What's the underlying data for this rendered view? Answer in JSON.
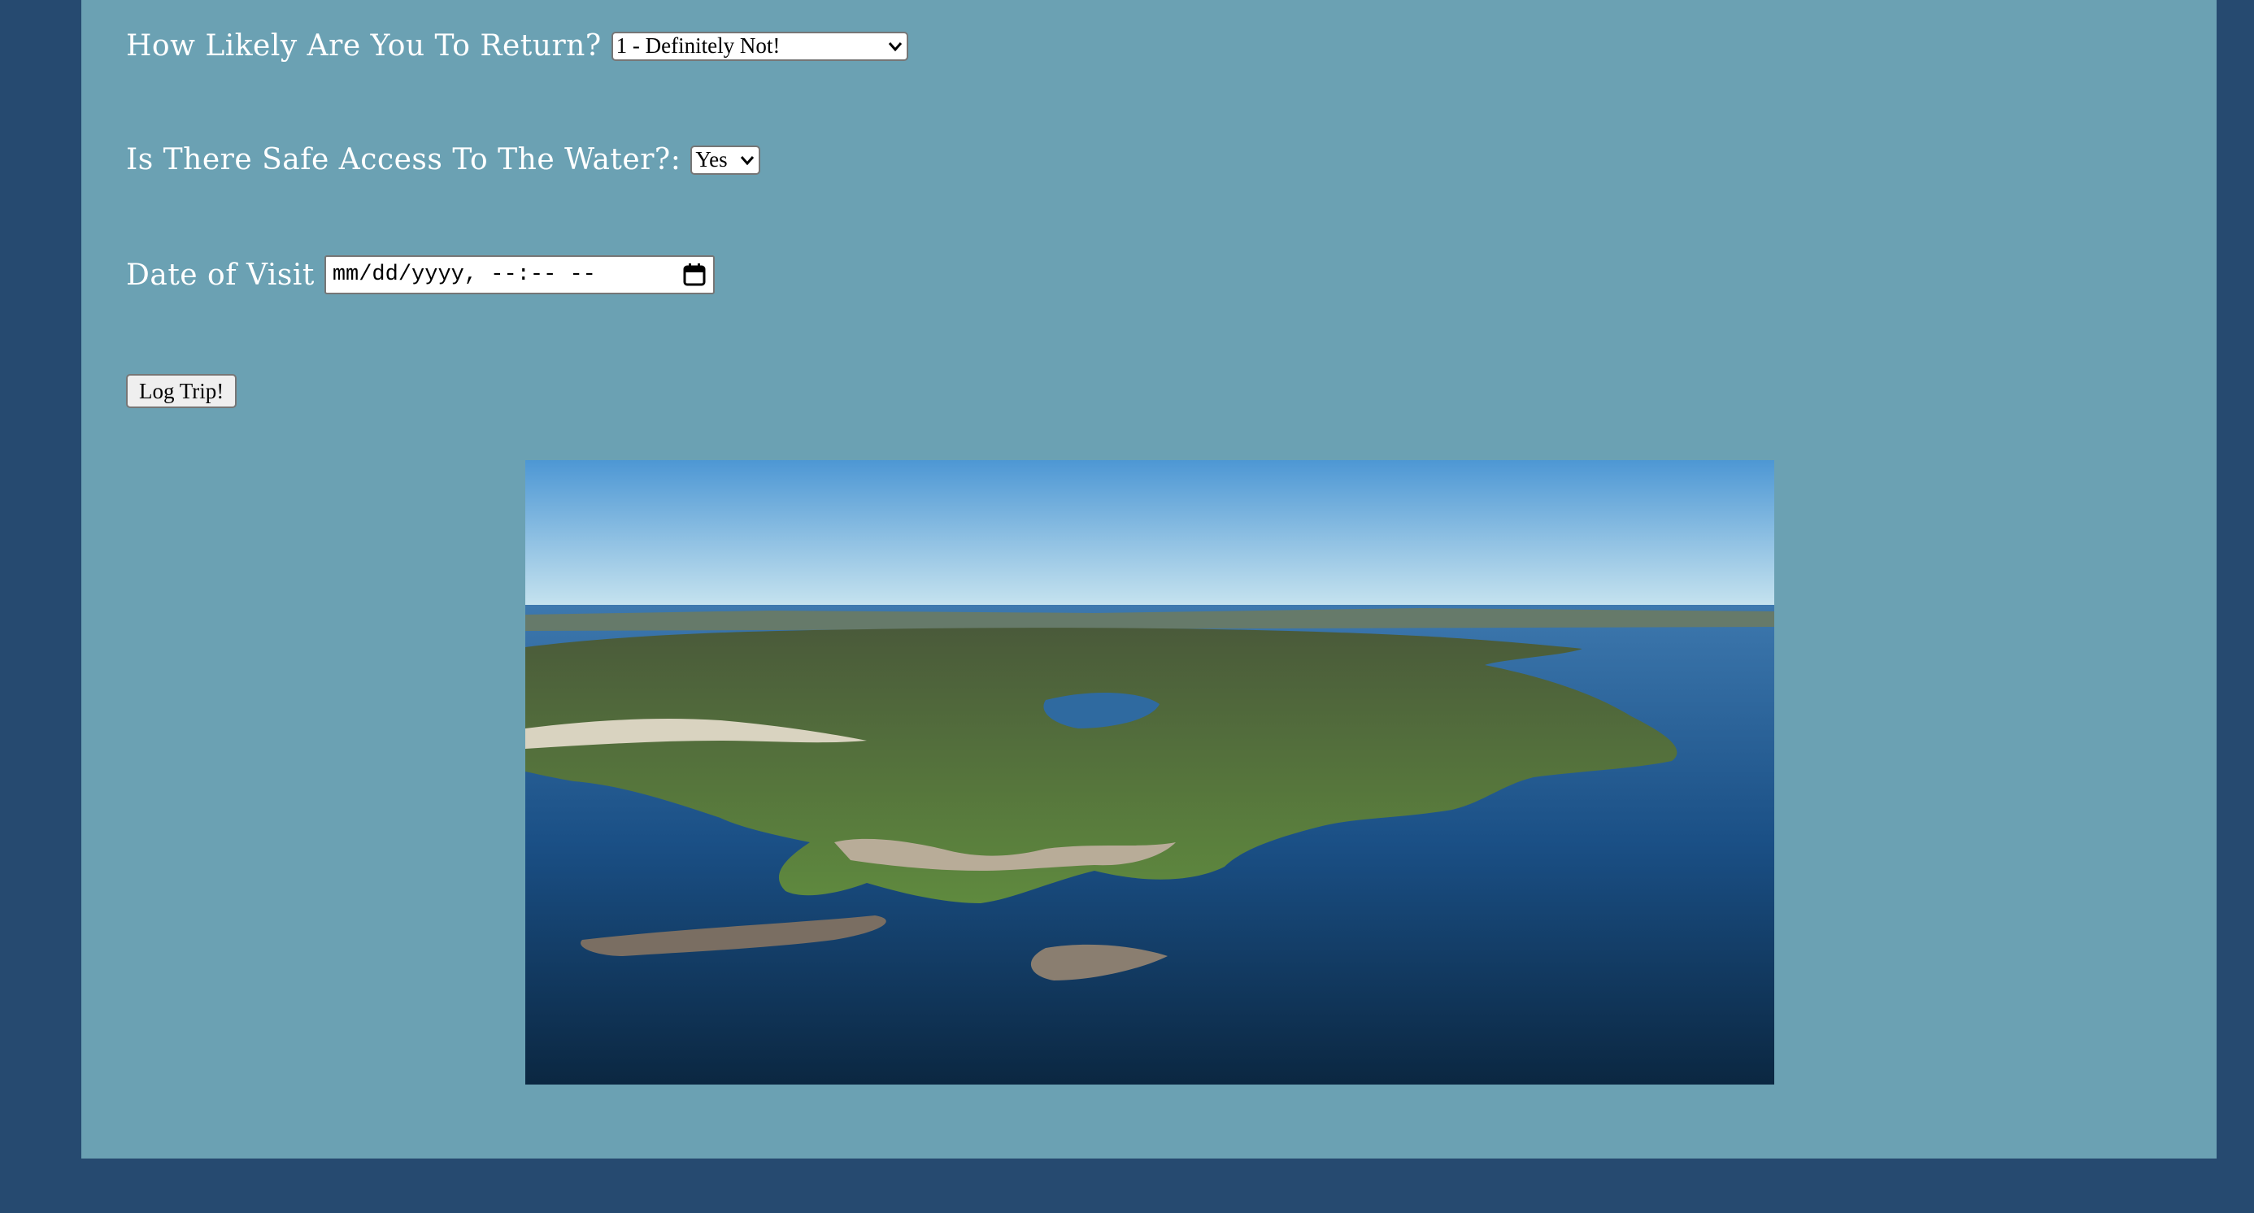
{
  "form": {
    "return_label": "How Likely Are You To Return?",
    "return_value": "1 - Definitely Not!",
    "water_label": "Is There Safe Access To The Water?:",
    "water_value": "Yes",
    "date_label": "Date of Visit",
    "date_placeholder": "mm/dd/yyyy, --:-- --",
    "submit_label": "Log Trip!"
  },
  "icons": {
    "select_arrow": "chevron-down-icon",
    "date_picker": "calendar-icon"
  },
  "colors": {
    "page_background": "#264a70",
    "panel_background": "#6ba1b3",
    "label_text": "#ffffff"
  }
}
